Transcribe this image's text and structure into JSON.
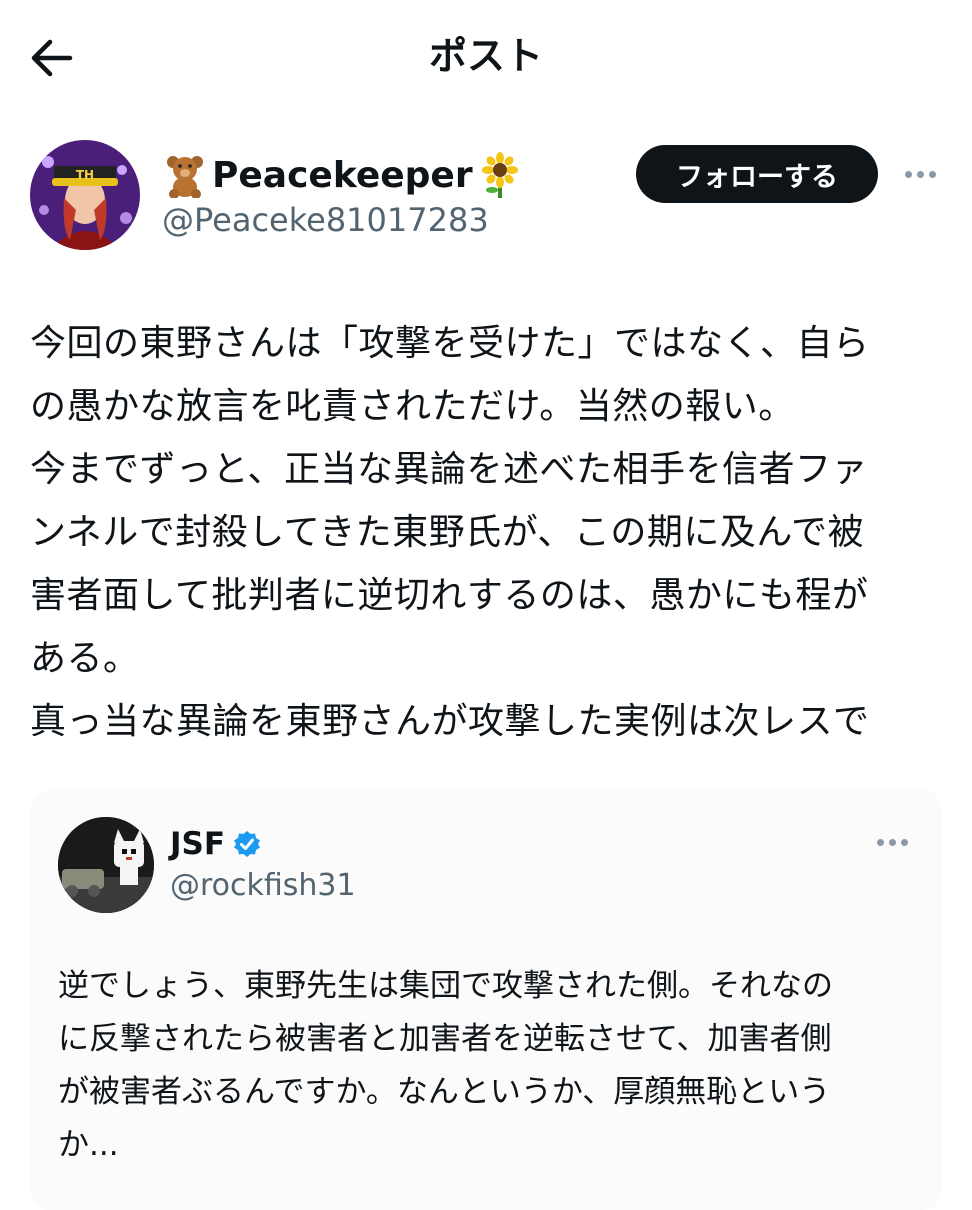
{
  "header": {
    "title": "ポスト",
    "back_icon": "arrow-left-icon"
  },
  "author": {
    "name": "Peacekeeper",
    "prefix_emoji": "teddy-bear-icon",
    "suffix_emoji": "sunflower-icon",
    "handle": "@Peaceke81017283",
    "follow_label": "フォローする",
    "more_icon": "more-horizontal-icon"
  },
  "post": {
    "lines": [
      "今回の東野さんは「攻撃を受けた」ではなく、自ら",
      "の愚かな放言を叱責されただけ。当然の報い。",
      "今までずっと、正当な異論を述べた相手を信者ファ",
      "ンネルで封殺してきた東野氏が、この期に及んで被",
      "害者面して批判者に逆切れするのは、愚かにも程が",
      "ある。",
      "真っ当な異論を東野さんが攻撃した実例は次レスで"
    ]
  },
  "quote": {
    "name": "JSF",
    "verified_icon": "verified-badge-icon",
    "handle": "@rockfish31",
    "more_icon": "more-horizontal-icon",
    "lines": [
      "逆でしょう、東野先生は集団で攻撃された側。それなの",
      "に反撃されたら被害者と加害者を逆転させて、加害者側",
      "が被害者ぶるんですか。なんというか、厚顔無恥という",
      "か..."
    ]
  },
  "colors": {
    "text": "#0f1419",
    "secondary": "#536471",
    "follow_bg": "#0f1419",
    "verified": "#1d9bf0"
  }
}
